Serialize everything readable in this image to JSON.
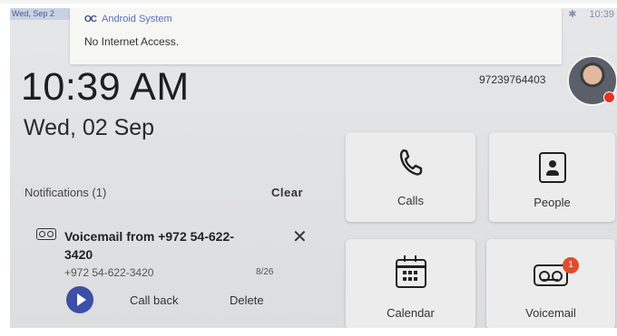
{
  "status_bar": {
    "left_text": "Wed, Sep 2",
    "right_icon": "bluetooth-icon",
    "time": "10:39"
  },
  "system_notification": {
    "app_name": "Android System",
    "app_icon": "android-system-icon",
    "message": "No Internet Access."
  },
  "clock": {
    "time": "10:39 AM",
    "date": "Wed, 02 Sep"
  },
  "account": {
    "number": "97239764403",
    "status_color": "#e8321f"
  },
  "notifications": {
    "header": "Notifications (1)",
    "clear_label": "Clear",
    "items": [
      {
        "title": "Voicemail from +972 54-622-3420",
        "subtitle": "+972 54-622-3420",
        "date": "8/26",
        "actions": [
          "Call back",
          "Delete"
        ],
        "icon": "voicemail-icon"
      }
    ]
  },
  "tiles": [
    {
      "label": "Calls",
      "icon": "phone-icon"
    },
    {
      "label": "People",
      "icon": "contact-icon"
    },
    {
      "label": "Calendar",
      "icon": "calendar-icon"
    },
    {
      "label": "Voicemail",
      "icon": "voicemail-icon",
      "badge": "1"
    }
  ],
  "colors": {
    "accent": "#3d4fa6",
    "badge": "#e14b2c"
  }
}
